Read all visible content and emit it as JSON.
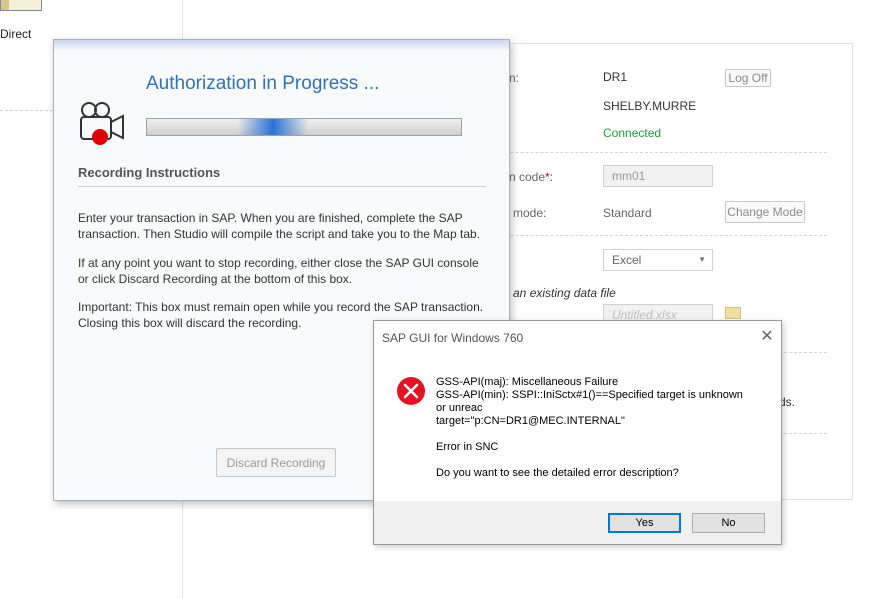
{
  "background": {
    "left_label": "Direct",
    "fields": {
      "system_label": "n:",
      "system_value": "DR1",
      "logoff_label": "Log Off",
      "user_value": "SHELBY.MURRE",
      "status_value": "Connected",
      "tcode_label": "n code",
      "tcode_required": "*:",
      "tcode_value": "mm01",
      "mode_label": "mode:",
      "mode_value": "Standard",
      "change_mode_label": "Change Mode",
      "format_value": "Excel",
      "existing_file_label": "e an existing data file",
      "file_placeholder": "Untitled.xlsx",
      "partial_text": "ds."
    }
  },
  "recording": {
    "title": "Authorization in Progress ...",
    "progress": 0.4,
    "section_title": "Recording Instructions",
    "para1": "Enter your transaction in SAP. When you are finished, complete the SAP transaction. Then Studio will compile the script and take you to the Map tab.",
    "para2": "If at any point you want to stop recording, either close the SAP GUI console or click Discard Recording at the bottom of this box.",
    "para3": "Important: This box must remain open while you record the SAP transaction. Closing this box will discard the recording.",
    "discard_label": "Discard Recording"
  },
  "error_dialog": {
    "title": "SAP GUI for Windows 760",
    "close_glyph": "✕",
    "line1": "GSS-API(maj): Miscellaneous Failure",
    "line2": "GSS-API(min): SSPI::IniSctx#1()==Specified target is unknown",
    "line3": "or unreac",
    "line4": "target=\"p:CN=DR1@MEC.INTERNAL\"",
    "line5": "Error in SNC",
    "line6": "Do you want to see the detailed error description?",
    "yes_label": "Yes",
    "no_label": "No"
  },
  "colors": {
    "title_blue": "#2e73b9",
    "connected_green": "#1e9e3a",
    "error_red": "#e81123",
    "recording_red": "#e00000"
  },
  "icons": [
    "video-camera-record-icon",
    "error-x-icon",
    "close-icon",
    "folder-icon",
    "dropdown-arrow-icon"
  ]
}
